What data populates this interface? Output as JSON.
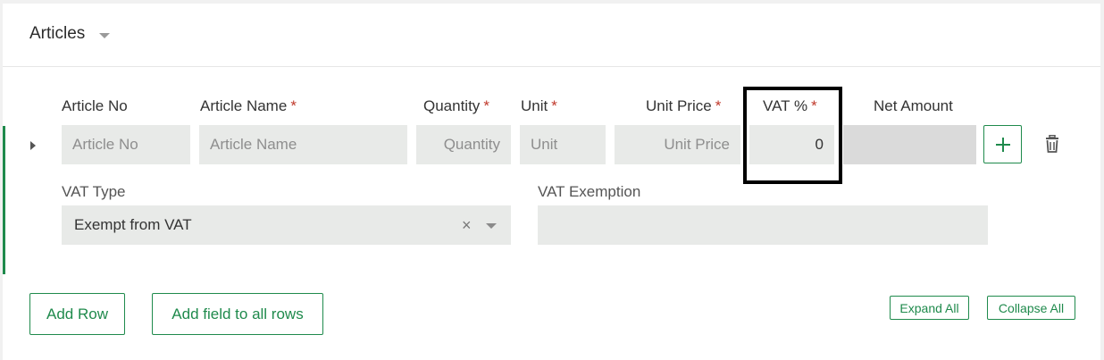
{
  "section": {
    "title": "Articles"
  },
  "columns": {
    "article_no": "Article No",
    "article_name": "Article Name",
    "quantity": "Quantity",
    "unit": "Unit",
    "unit_price": "Unit Price",
    "vat_percent": "VAT %",
    "net_amount": "Net Amount",
    "required_marker": "*"
  },
  "row": {
    "article_no_placeholder": "Article No",
    "article_name_placeholder": "Article Name",
    "quantity_placeholder": "Quantity",
    "unit_placeholder": "Unit",
    "unit_price_placeholder": "Unit Price",
    "vat_percent_value": "0",
    "net_amount_value": ""
  },
  "details": {
    "vat_type_label": "VAT Type",
    "vat_type_value": "Exempt from VAT",
    "vat_exemption_label": "VAT Exemption",
    "vat_exemption_value": ""
  },
  "actions": {
    "add_row": "Add Row",
    "add_field_to_all_rows": "Add field to all rows",
    "expand_all": "Expand All",
    "collapse_all": "Collapse All",
    "clear_symbol": "×"
  },
  "colors": {
    "accent": "#1f8a4c",
    "required": "#c0392b",
    "field_bg": "#e8eae8"
  }
}
